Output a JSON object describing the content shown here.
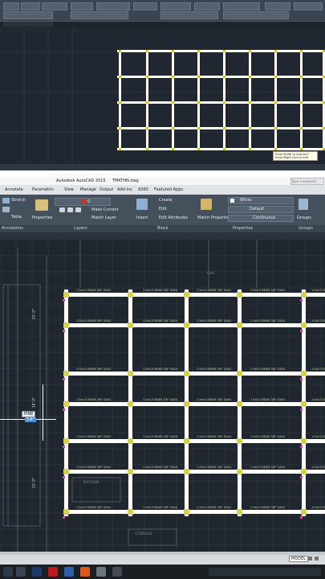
{
  "top": {
    "tooltip_line1": "Press PLINE to Line/Arc?",
    "tooltip_line2": "Enter/Right-click to exit"
  },
  "window": {
    "title": "Autodesk AutoCAD 2015",
    "file": "TMKTHN.dwg",
    "search_hint": "Type a keyword"
  },
  "menu": [
    "Annotate",
    "Parametric",
    "View",
    "Manage",
    "Output",
    "Add-ins",
    "A360",
    "Featured Apps"
  ],
  "ribbon": {
    "stretch": "Stretch",
    "table": "Table",
    "properties": "Properties",
    "make_current": "Make Current",
    "match_layer": "Match Layer",
    "insert": "Insert",
    "create": "Create",
    "edit": "Edit",
    "edit_attributes": "Edit Attributes",
    "match_properties": "Match Properties",
    "layer_value": "0",
    "color_value": "White",
    "linetype_value": "Default",
    "lineweight_value": "Continuous",
    "groups": "Groups"
  },
  "panels": {
    "annotation": "Annotation",
    "layers": "Layers",
    "block": "Block",
    "properties": "Properties",
    "groups": "Groups"
  },
  "drawing": {
    "cursor_label": "PINE",
    "cursor_sub": "5'6\"",
    "dim_labels": [
      "20'-0\"",
      "18'-0\"",
      "12'-0\""
    ],
    "label_text": "1.5x4.5 BEAM 3/8\" GALV.",
    "notes": [
      "GAS",
      "STORAGE",
      "KITCHEN"
    ]
  },
  "status": {
    "model": "MODEL"
  }
}
